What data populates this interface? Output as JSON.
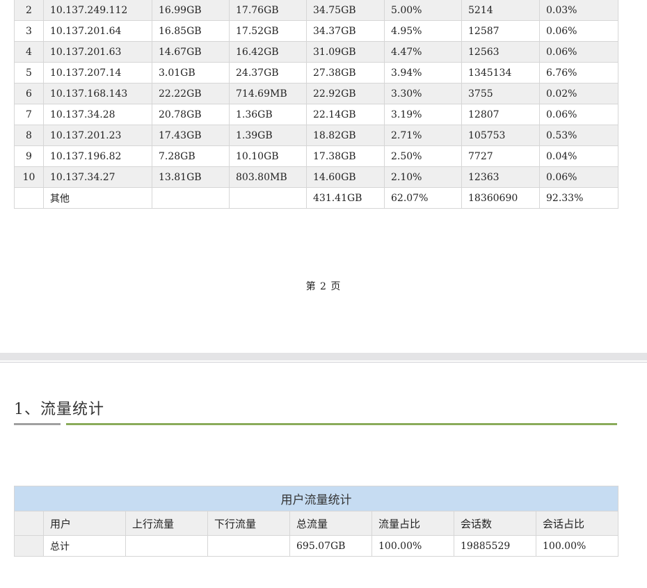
{
  "top_table": {
    "rows": [
      {
        "idx": "2",
        "ip": "10.137.249.112",
        "up": "16.99GB",
        "down": "17.76GB",
        "total": "34.75GB",
        "traffic_pct": "5.00%",
        "sessions": "5214",
        "session_pct": "0.03%"
      },
      {
        "idx": "3",
        "ip": "10.137.201.64",
        "up": "16.85GB",
        "down": "17.52GB",
        "total": "34.37GB",
        "traffic_pct": "4.95%",
        "sessions": "12587",
        "session_pct": "0.06%"
      },
      {
        "idx": "4",
        "ip": "10.137.201.63",
        "up": "14.67GB",
        "down": "16.42GB",
        "total": "31.09GB",
        "traffic_pct": "4.47%",
        "sessions": "12563",
        "session_pct": "0.06%"
      },
      {
        "idx": "5",
        "ip": "10.137.207.14",
        "up": "3.01GB",
        "down": "24.37GB",
        "total": "27.38GB",
        "traffic_pct": "3.94%",
        "sessions": "1345134",
        "session_pct": "6.76%"
      },
      {
        "idx": "6",
        "ip": "10.137.168.143",
        "up": "22.22GB",
        "down": "714.69MB",
        "total": "22.92GB",
        "traffic_pct": "3.30%",
        "sessions": "3755",
        "session_pct": "0.02%"
      },
      {
        "idx": "7",
        "ip": "10.137.34.28",
        "up": "20.78GB",
        "down": "1.36GB",
        "total": "22.14GB",
        "traffic_pct": "3.19%",
        "sessions": "12807",
        "session_pct": "0.06%"
      },
      {
        "idx": "8",
        "ip": "10.137.201.23",
        "up": "17.43GB",
        "down": "1.39GB",
        "total": "18.82GB",
        "traffic_pct": "2.71%",
        "sessions": "105753",
        "session_pct": "0.53%"
      },
      {
        "idx": "9",
        "ip": "10.137.196.82",
        "up": "7.28GB",
        "down": "10.10GB",
        "total": "17.38GB",
        "traffic_pct": "2.50%",
        "sessions": "7727",
        "session_pct": "0.04%"
      },
      {
        "idx": "10",
        "ip": "10.137.34.27",
        "up": "13.81GB",
        "down": "803.80MB",
        "total": "14.60GB",
        "traffic_pct": "2.10%",
        "sessions": "12363",
        "session_pct": "0.06%"
      },
      {
        "idx": "",
        "ip": "其他",
        "up": "",
        "down": "",
        "total": "431.41GB",
        "traffic_pct": "62.07%",
        "sessions": "18360690",
        "session_pct": "92.33%"
      }
    ]
  },
  "page_number": "第 2 页",
  "section": {
    "heading": "1、流量统计"
  },
  "user_stats_table": {
    "title": "用户流量统计",
    "headers": {
      "user": "用户",
      "up": "上行流量",
      "down": "下行流量",
      "total": "总流量",
      "traffic_pct": "流量占比",
      "sessions": "会话数",
      "session_pct": "会话占比"
    },
    "row": {
      "user": "总计",
      "up": "",
      "down": "",
      "total": "695.07GB",
      "traffic_pct": "100.00%",
      "sessions": "19885529",
      "session_pct": "100.00%"
    }
  }
}
